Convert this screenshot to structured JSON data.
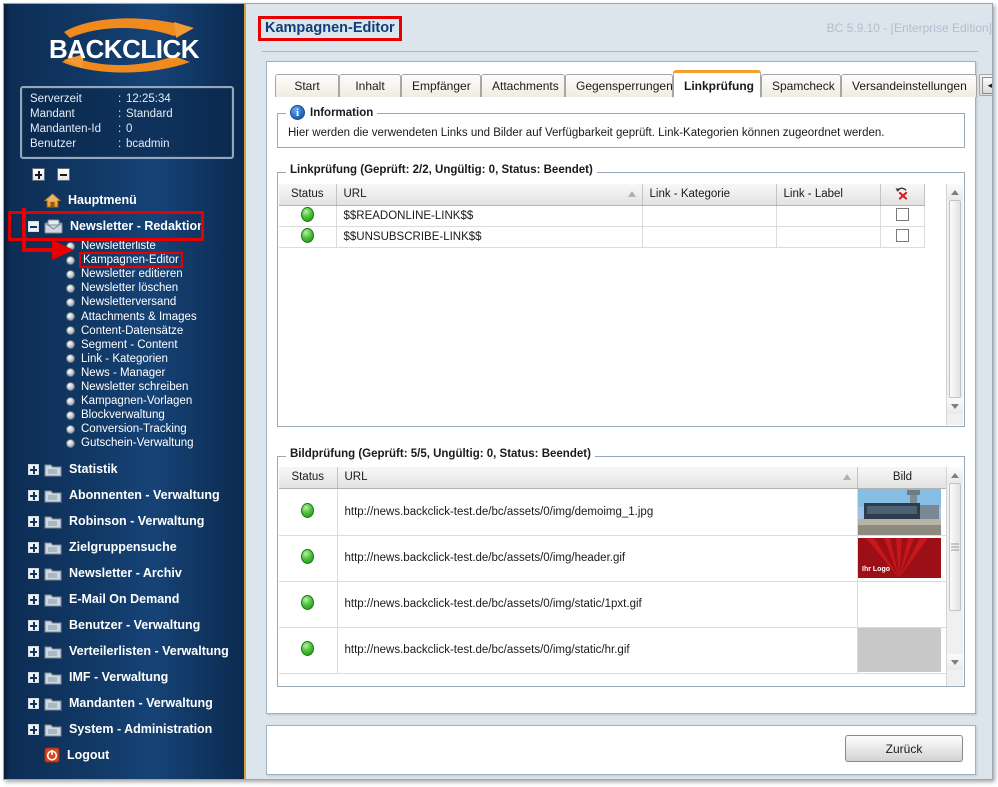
{
  "app": {
    "brand": "BACKCLICK",
    "version_label": "BC 5.9.10 - [Enterprise Edition]"
  },
  "sidebar": {
    "server_info": [
      {
        "key": "Serverzeit",
        "sep": ":",
        "value": "12:25:34"
      },
      {
        "key": "Mandant",
        "sep": ":",
        "value": "Standard"
      },
      {
        "key": "Mandanten-Id",
        "sep": ":",
        "value": "0"
      },
      {
        "key": "Benutzer",
        "sep": ":",
        "value": "bcadmin"
      }
    ],
    "expand_all_label": "+",
    "collapse_all_label": "-",
    "home_item": {
      "label": "Hauptmenü",
      "icon": "house-icon"
    },
    "open_group": {
      "label": "Newsletter - Redaktion",
      "icon": "newsletter-folder-icon",
      "children": [
        "Newsletterliste",
        "Kampagnen-Editor",
        "Newsletter editieren",
        "Newsletter löschen",
        "Newsletterversand",
        "Attachments & Images",
        "Content-Datensätze",
        "Segment - Content",
        "Link - Kategorien",
        "News - Manager",
        "Newsletter schreiben",
        "Kampagnen-Vorlagen",
        "Blockverwaltung",
        "Conversion-Tracking",
        "Gutschein-Verwaltung"
      ],
      "selected_child": "Kampagnen-Editor"
    },
    "groups": [
      "Statistik",
      "Abonnenten - Verwaltung",
      "Robinson - Verwaltung",
      "Zielgruppensuche",
      "Newsletter - Archiv",
      "E-Mail On Demand",
      "Benutzer - Verwaltung",
      "Verteilerlisten - Verwaltung",
      "IMF - Verwaltung",
      "Mandanten - Verwaltung",
      "System - Administration"
    ],
    "logout": {
      "label": "Logout",
      "icon": "power-icon"
    }
  },
  "header": {
    "page_title": "Kampagnen-Editor"
  },
  "tabs": {
    "items": [
      {
        "label": "Start",
        "active": false
      },
      {
        "label": "Inhalt",
        "active": false
      },
      {
        "label": "Empfänger",
        "active": false
      },
      {
        "label": "Attachments",
        "active": false
      },
      {
        "label": "Gegensperrungen",
        "active": false
      },
      {
        "label": "Linkprüfung",
        "active": true
      },
      {
        "label": "Spamcheck",
        "active": false
      },
      {
        "label": "Versandeinstellungen",
        "active": false
      }
    ],
    "scroll_prev": "◄",
    "scroll_next": "►"
  },
  "information": {
    "legend": "Information",
    "icon": "info-icon",
    "text": "Hier werden die verwendeten Links und Bilder auf Verfügbarkeit geprüft. Link-Kategorien können zugeordnet werden."
  },
  "link_check": {
    "legend": "Linkprüfung (Geprüft: 2/2,  Ungültig: 0,  Status: Beendet)",
    "checked": "2/2",
    "invalid": "0",
    "status": "Beendet",
    "columns": [
      {
        "label": "Status",
        "name": "status"
      },
      {
        "label": "URL",
        "name": "url",
        "sorted": "asc"
      },
      {
        "label": "Link - Kategorie",
        "name": "link-kategorie"
      },
      {
        "label": "Link - Label",
        "name": "link-label"
      },
      {
        "label": "",
        "name": "reset-column",
        "icon": "undo-delete-icon"
      }
    ],
    "rows": [
      {
        "status": "ok",
        "url": "$$READONLINE-LINK$$",
        "kategorie": "",
        "label": "",
        "checked": false
      },
      {
        "status": "ok",
        "url": "$$UNSUBSCRIBE-LINK$$",
        "kategorie": "",
        "label": "",
        "checked": false
      }
    ]
  },
  "image_check": {
    "legend": "Bildprüfung (Geprüft: 5/5,  Ungültig: 0,  Status: Beendet)",
    "checked": "5/5",
    "invalid": "0",
    "status": "Beendet",
    "columns": [
      {
        "label": "Status",
        "name": "status"
      },
      {
        "label": "URL",
        "name": "url",
        "sorted": "asc"
      },
      {
        "label": "Bild",
        "name": "bild"
      }
    ],
    "rows": [
      {
        "status": "ok",
        "url": "http://news.backclick-test.de/bc/assets/0/img/demoimg_1.jpg",
        "thumb": "photo-building"
      },
      {
        "status": "ok",
        "url": "http://news.backclick-test.de/bc/assets/0/img/header.gif",
        "thumb": "red-banner",
        "thumb_text": "Ihr Logo"
      },
      {
        "status": "ok",
        "url": "http://news.backclick-test.de/bc/assets/0/img/static/1pxt.gif",
        "thumb": "none"
      },
      {
        "status": "ok",
        "url": "http://news.backclick-test.de/bc/assets/0/img/static/hr.gif",
        "thumb": "gray-block"
      }
    ]
  },
  "footer": {
    "back_label": "Zurück"
  },
  "colors": {
    "sidebar_dark": "#0c2c53",
    "sidebar_light": "#164377",
    "accent_orange": "#f2a22c",
    "highlight_red": "#e60000",
    "title_blue": "#0d3e78",
    "status_green": "#4ec23e",
    "content_bg": "#dce4ec"
  }
}
